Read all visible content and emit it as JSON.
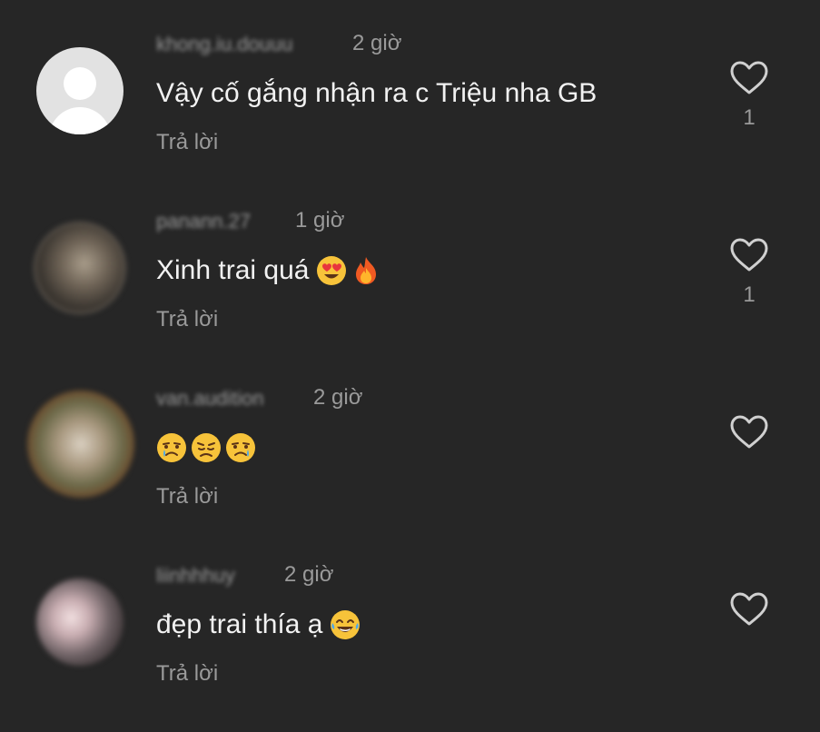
{
  "comments": [
    {
      "username": "khong.iu.douuu",
      "time": "2 giờ",
      "text": "Vậy cố gắng nhận ra c Triệu nha GB",
      "emojis": [],
      "reply_label": "Trả lời",
      "like_count": "1",
      "avatar": "default-avatar"
    },
    {
      "username": "panann.27",
      "time": "1 giờ",
      "text": "Xinh trai quá",
      "emojis": [
        "heart-eyes-emoji",
        "fire-emoji"
      ],
      "reply_label": "Trả lời",
      "like_count": "1",
      "avatar": "photo-avatar"
    },
    {
      "username": "van.audition",
      "time": "2 giờ",
      "text": "",
      "emojis": [
        "crying-face-emoji",
        "sad-face-emoji",
        "crying-face-emoji"
      ],
      "reply_label": "Trả lời",
      "like_count": "",
      "avatar": "photo-avatar"
    },
    {
      "username": "liinhhhuy",
      "time": "2 giờ",
      "text": "đẹp trai thía ạ",
      "emojis": [
        "tears-of-joy-emoji"
      ],
      "reply_label": "Trả lời",
      "like_count": "",
      "avatar": "photo-avatar"
    }
  ],
  "colors": {
    "background": "#262626",
    "primary_text": "#f2f2f2",
    "secondary_text": "#9a9a9a",
    "heart_outline": "#d0d0d0",
    "emoji_yellow": "#f7c33a"
  },
  "icons": {
    "like": "heart-outline-icon"
  }
}
